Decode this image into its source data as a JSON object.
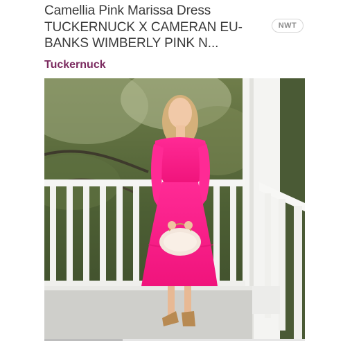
{
  "listing": {
    "title_line1": "Camellia Pink Marissa Dress",
    "title_line2": "TUCKERNUCK X CAMERAN EU-",
    "title_line3": "BANKS WIMBERLY PINK N...",
    "condition_badge": "NWT",
    "brand": "Tuckernuck"
  },
  "photo": {
    "subject": "woman-in-pink-dress-on-porch",
    "dress_color": "#ff1f8f"
  },
  "colors": {
    "brand": "#7b2a5f",
    "title": "#3a3a3a"
  }
}
